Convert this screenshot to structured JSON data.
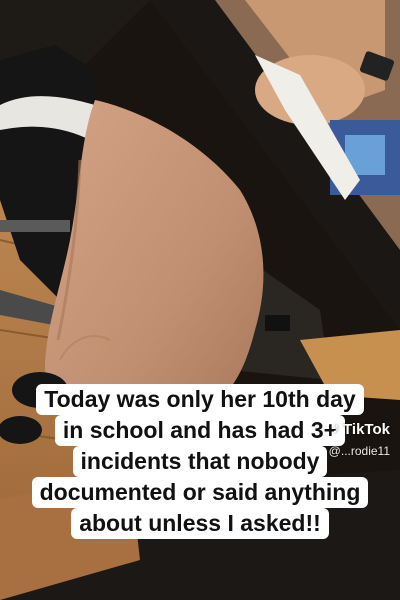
{
  "caption": {
    "lines": [
      "Today was only her 10th day",
      "in school and has had 3+",
      "incidents that nobody",
      "documented or said anything",
      "about unless I asked!!"
    ]
  },
  "watermark": {
    "brand": "TikTok",
    "handle": "@...rodie11"
  },
  "colors": {
    "caption_bg": "#ffffff",
    "caption_text": "#111111",
    "dress": "#c8967a",
    "desk": "#1a1612",
    "floor": "#b07a45"
  }
}
